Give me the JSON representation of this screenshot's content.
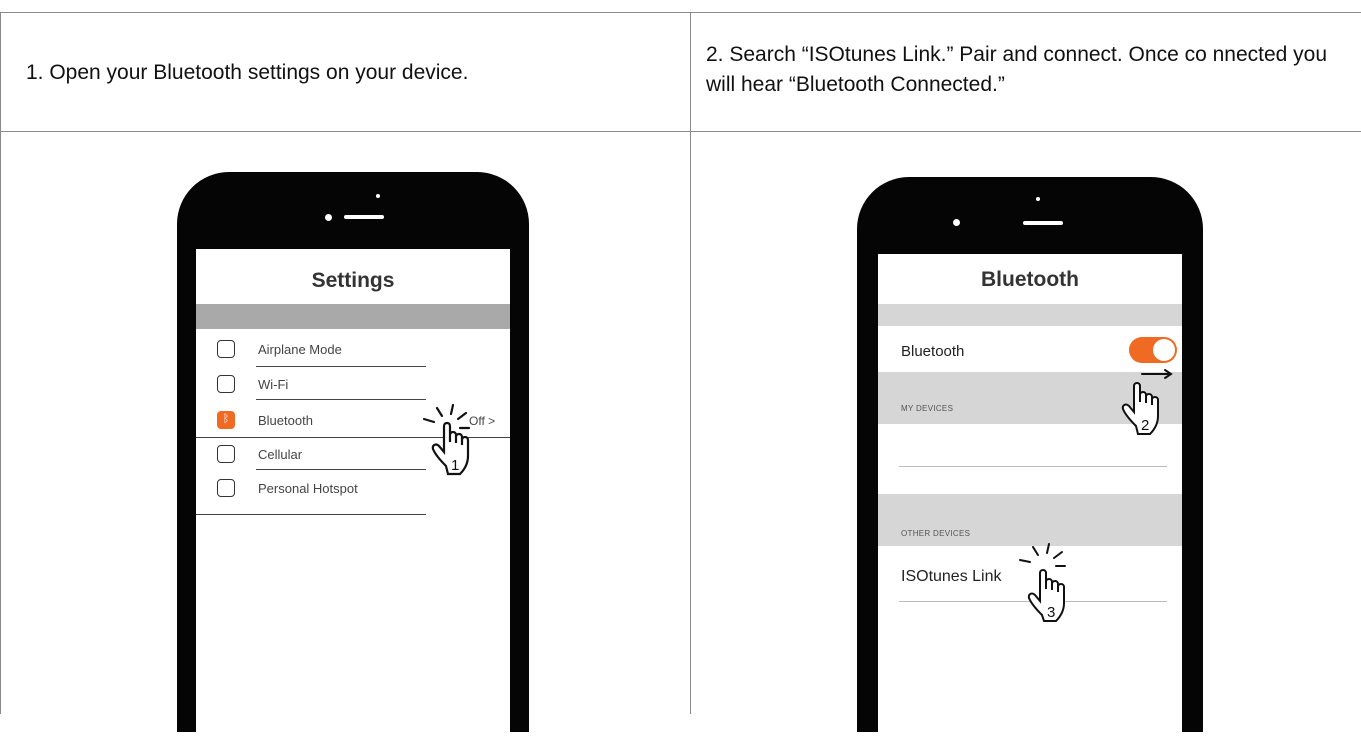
{
  "steps": [
    {
      "caption": "1. Open your Bluetooth settings on your device.",
      "screen_title": "Settings",
      "rows": [
        {
          "label": "Airplane Mode",
          "icon": "checkbox-icon"
        },
        {
          "label": "Wi-Fi",
          "icon": "checkbox-icon"
        },
        {
          "label": "Bluetooth",
          "icon": "bluetooth-icon",
          "value": "Off >"
        },
        {
          "label": "Cellular",
          "icon": "checkbox-icon"
        },
        {
          "label": "Personal Hotspot",
          "icon": "checkbox-icon"
        }
      ],
      "hand_number": "1"
    },
    {
      "caption": "2. Search “ISOtunes Link.” Pair and connect. Once co nnected you will hear “Bluetooth Connected.”",
      "screen_title": "Bluetooth",
      "bluetooth_label": "Bluetooth",
      "my_devices": "MY DEVICES",
      "other_devices": "OTHER DEVICES",
      "device": "ISOtunes Link",
      "hand_numbers": [
        "2",
        "3"
      ]
    }
  ],
  "colors": {
    "accent": "#ef6a22",
    "border": "#8a8a8a"
  }
}
